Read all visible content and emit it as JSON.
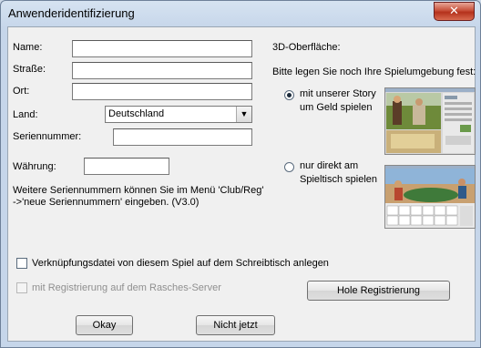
{
  "window": {
    "title": "Anwenderidentifizierung",
    "close_label": "✕"
  },
  "form": {
    "name_label": "Name:",
    "street_label": "Straße:",
    "city_label": "Ort:",
    "country_label": "Land:",
    "country_value": "Deutschland",
    "serial_label": "Seriennummer:",
    "currency_label": "Währung:",
    "name_value": "",
    "street_value": "",
    "city_value": "",
    "serial_value": "",
    "currency_value": ""
  },
  "info_text_line1": "Weitere Seriennummern können Sie im Menü 'Club/Reg'",
  "info_text_line2": "->'neue Seriennummern' eingeben. (V3.0)",
  "surface": {
    "heading": "3D-Oberfläche:",
    "prompt": "Bitte legen Sie noch Ihre Spielumgebung fest:",
    "option1_line1": "mit unserer Story",
    "option1_line2": "um Geld spielen",
    "option2_line1": "nur direkt am",
    "option2_line2": "Spieltisch spielen"
  },
  "checkbox_desktop_link": "Verknüpfungsdatei von diesem Spiel auf dem Schreibtisch anlegen",
  "checkbox_register_server": "mit Registrierung auf dem Rasches-Server",
  "buttons": {
    "fetch_registration": "Hole Registrierung",
    "okay": "Okay",
    "not_now": "Nicht jetzt"
  }
}
